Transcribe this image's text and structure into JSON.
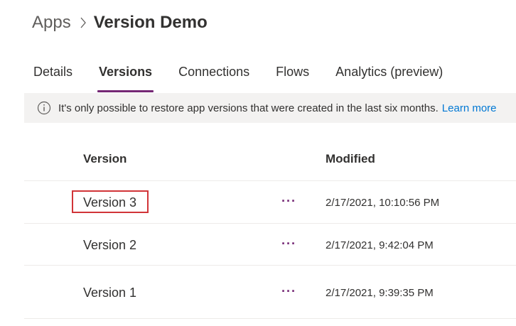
{
  "breadcrumb": {
    "root": "Apps",
    "separator_icon": "chevron-right-icon",
    "current": "Version Demo"
  },
  "tabs": [
    {
      "label": "Details",
      "active": false
    },
    {
      "label": "Versions",
      "active": true
    },
    {
      "label": "Connections",
      "active": false
    },
    {
      "label": "Flows",
      "active": false
    },
    {
      "label": "Analytics (preview)",
      "active": false
    }
  ],
  "banner": {
    "icon": "info-icon",
    "text": "It's only possible to restore app versions that were created in the last six months.",
    "link": "Learn more"
  },
  "table": {
    "columns": {
      "version": "Version",
      "modified": "Modified"
    },
    "rows": [
      {
        "name": "Version 3",
        "more": "···",
        "modified": "2/17/2021, 10:10:56 PM",
        "highlighted": true
      },
      {
        "name": "Version 2",
        "more": "···",
        "modified": "2/17/2021, 9:42:04 PM",
        "highlighted": false
      },
      {
        "name": "Version 1",
        "more": "···",
        "modified": "2/17/2021, 9:39:35 PM",
        "highlighted": false
      }
    ]
  },
  "colors": {
    "accent": "#742774",
    "link": "#0078d4",
    "banner_bg": "#f3f2f1",
    "highlight_border": "#d13438"
  }
}
